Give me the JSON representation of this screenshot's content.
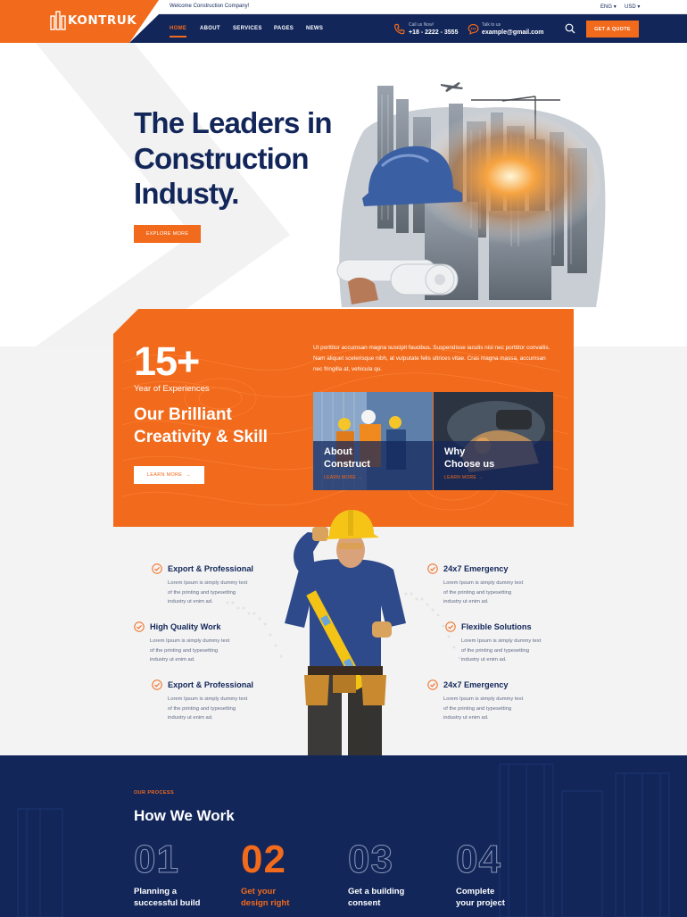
{
  "brand": {
    "name": "KONTRUK",
    "accent": "#f26a1b",
    "navy": "#12265a"
  },
  "topbar": {
    "welcome": "Welcome Construction Company!",
    "language": "ENG",
    "currency": "USD"
  },
  "nav": {
    "items": [
      "HOME",
      "ABOUT",
      "SERVICES",
      "PAGES",
      "NEWS"
    ],
    "active": "HOME"
  },
  "contact": {
    "phone_label": "Call us Now!",
    "phone": "+18 - 2222 - 3555",
    "email_label": "Talk to us",
    "email": "example@gmail.com"
  },
  "header": {
    "quote_button": "GET A QUOTE"
  },
  "hero": {
    "title_lines": [
      "The Leaders in",
      "Construction",
      "Industy."
    ],
    "button": "EXPLORE MORE"
  },
  "experience": {
    "years": "15+",
    "years_label": "Year of Experiences",
    "headline_lines": [
      "Our Brilliant",
      "Creativity & Skill"
    ],
    "button": "LEARN MORE",
    "text": "Ut porttitor accumsan magna suscipit faucibus. Suspendisse iaculis nisl nec porttitor convallis. Nam aliquet scelerisque nibh, at vulputate felis ultrices vitae. Cras magna massa, accumsan nec fringilla at, vehicula qu.",
    "cards": [
      {
        "title_lines": [
          "About",
          "Construct"
        ],
        "link": "LEARN MORE"
      },
      {
        "title_lines": [
          "Why",
          "Choose us"
        ],
        "link": "LEARN MORE"
      }
    ]
  },
  "features": [
    {
      "title": "Export & Professional",
      "text_lines": [
        "Lorem Ipsum is simply dummy text",
        "of the printing and typesetting",
        "industry ut enim ad."
      ]
    },
    {
      "title": "High Quality Work",
      "text_lines": [
        "Lorem Ipsum is simply dummy text",
        "of the printing and typesetting",
        "industry ut enim ad."
      ]
    },
    {
      "title": "Export & Professional",
      "text_lines": [
        "Lorem Ipsum is simply dummy text",
        "of the printing and typesetting",
        "industry ut enim ad."
      ]
    },
    {
      "title": "24x7 Emergency",
      "text_lines": [
        "Lorem Ipsum is simply dummy text",
        "of the printing and typesetting",
        "industry ut enim ad."
      ]
    },
    {
      "title": "Flexible Solutions",
      "text_lines": [
        "Lorem Ipsum is simply dummy text",
        "of the printing and typesetting",
        "industry ut enim ad."
      ]
    },
    {
      "title": "24x7 Emergency",
      "text_lines": [
        "Lorem Ipsum is simply dummy text",
        "of the printing and typesetting",
        "industry ut enim ad."
      ]
    }
  ],
  "process": {
    "eyebrow": "OUR PROCESS",
    "title": "How We Work",
    "steps": [
      {
        "number": "01",
        "label_lines": [
          "Planning a",
          "successful build"
        ]
      },
      {
        "number": "02",
        "label_lines": [
          "Get your",
          "design right"
        ]
      },
      {
        "number": "03",
        "label_lines": [
          "Get a building",
          "consent"
        ]
      },
      {
        "number": "04",
        "label_lines": [
          "Complete",
          "your project"
        ]
      }
    ],
    "active_step": "02"
  },
  "icons": {
    "phone": "phone-icon",
    "email": "chat-icon",
    "search": "search-icon",
    "check": "check-circle-icon",
    "arrow": "arrow-right-icon",
    "logo": "building-logo-icon"
  }
}
